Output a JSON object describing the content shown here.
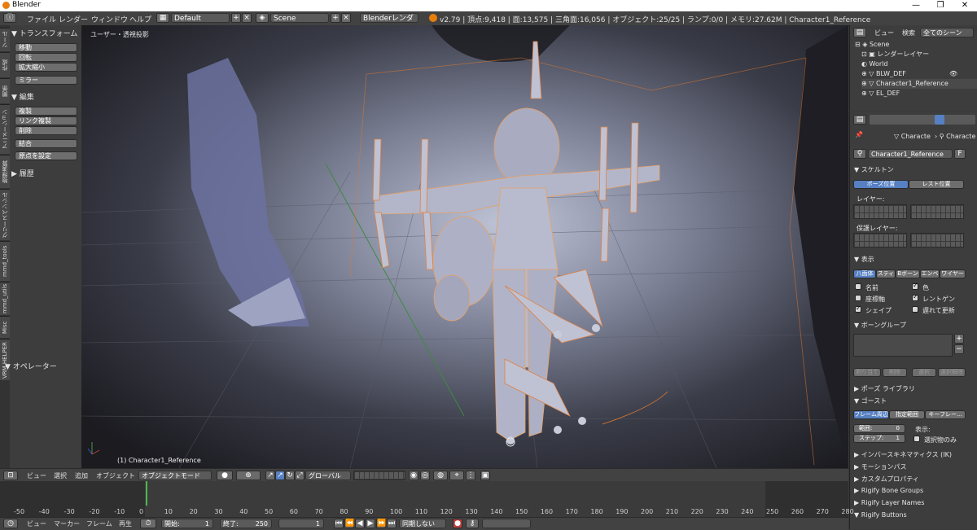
{
  "window": {
    "title": "Blender",
    "minimize": "—",
    "maximize": "❐",
    "close": "✕"
  },
  "menu": {
    "items": [
      "ファイル",
      "レンダー",
      "ウィンドウ",
      "ヘルプ"
    ],
    "layout": "Default",
    "scene": "Scene",
    "engine": "Blenderレンダー",
    "stats": "v2.79 | 頂点:9,418 | 面:13,575 | 三角面:16,056 | オブジェクト:25/25 | ランプ:0/0 | メモリ:27.62M | Character1_Reference"
  },
  "toolshelf": {
    "tabs": [
      "ツール",
      "作成",
      "関係",
      "アニメーション",
      "物理演算",
      "グリースペンシル",
      "mmd_tools",
      "mmd_utils",
      "Misc",
      "VRM HELPER"
    ],
    "transform_title": "トランスフォーム",
    "transform": [
      "移動",
      "回転",
      "拡大縮小",
      "ミラー"
    ],
    "edit_title": "編集",
    "edit": [
      "複製",
      "リンク複製",
      "削除",
      "結合",
      "原点を設定"
    ],
    "history_title": "履歴",
    "operator_title": "オペレーター"
  },
  "viewport": {
    "view_label": "ユーザー・透視投影",
    "object_label": "(1) Character1_Reference"
  },
  "outliner": {
    "view": "ビュー",
    "search": "検索",
    "filter": "全てのシーン",
    "items": [
      "Scene",
      "レンダーレイヤー",
      "World",
      "BLW_DEF",
      "Character1_Reference",
      "EL_DEF"
    ]
  },
  "properties": {
    "breadcrumb1": "Characte",
    "breadcrumb2": "Characte",
    "datablock": "Character1_Reference",
    "fake_user": "F",
    "skeleton": "スケルトン",
    "pose_position": "ポーズ位置",
    "rest_position": "レスト位置",
    "layers": "レイヤー:",
    "protected_layers": "保護レイヤー:",
    "display": "表示",
    "display_modes": [
      "八面体",
      "スティ",
      "Bボーン",
      "エンベ",
      "ワイヤー"
    ],
    "checks": [
      {
        "label": "名前",
        "on": false
      },
      {
        "label": "色",
        "on": true
      },
      {
        "label": "座標軸",
        "on": false
      },
      {
        "label": "レントゲン",
        "on": true
      },
      {
        "label": "シェイプ",
        "on": true
      },
      {
        "label": "遅れて更新",
        "on": false
      }
    ],
    "bone_groups": "ボーングループ",
    "bone_group_buttons": [
      "割り当て",
      "削除",
      "選択",
      "選択解除"
    ],
    "pose_library": "ポーズ ライブラリ",
    "ghost": "ゴースト",
    "ghost_modes": [
      "フレーム周辺",
      "指定範囲",
      "キーフレー..."
    ],
    "range": "範囲:",
    "range_value": "0",
    "step": "ステップ:",
    "step_value": "1",
    "ghost_display": "表示:",
    "selected_only": "選択物のみ",
    "sections": [
      "インバースキネマティクス (IK)",
      "モーションパス",
      "カスタムプロパティ",
      "Rigify Bone Groups",
      "Rigify Layer Names",
      "Rigify Buttons"
    ]
  },
  "view3d_header": {
    "view": "ビュー",
    "select": "選択",
    "add": "追加",
    "object": "オブジェクト",
    "mode": "オブジェクトモード",
    "orientation": "グローバル"
  },
  "timeline": {
    "ticks": [
      "-50",
      "-40",
      "-30",
      "-20",
      "-10",
      "0",
      "10",
      "20",
      "30",
      "40",
      "50",
      "60",
      "70",
      "80",
      "90",
      "100",
      "110",
      "120",
      "130",
      "140",
      "150",
      "160",
      "170",
      "180",
      "190",
      "200",
      "210",
      "220",
      "230",
      "240",
      "250",
      "260",
      "270",
      "280"
    ],
    "current_frame": 1
  },
  "timeline_header": {
    "view": "ビュー",
    "marker": "マーカー",
    "frame": "フレーム",
    "playback": "再生",
    "start_label": "開始:",
    "start": "1",
    "end_label": "終了:",
    "end": "250",
    "current": "1",
    "sync": "同期しない"
  }
}
